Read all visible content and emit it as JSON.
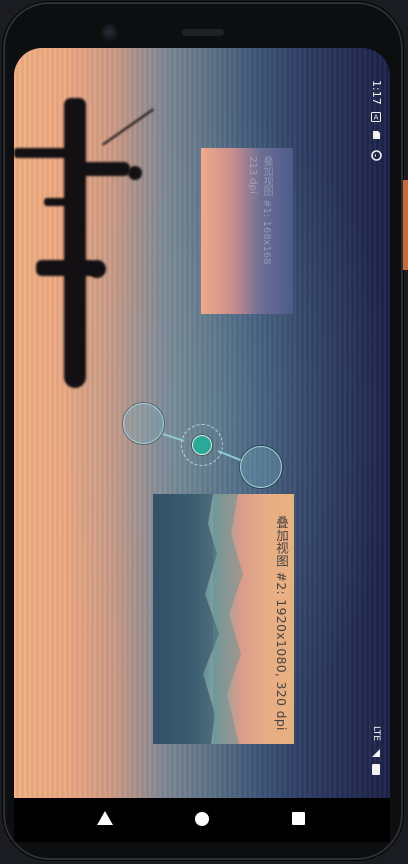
{
  "status_bar": {
    "time": "1:17",
    "network": "LTE",
    "icons": [
      "notification-a-icon",
      "sd-card-icon",
      "sync-icon",
      "signal-icon",
      "battery-icon"
    ]
  },
  "overlays": [
    {
      "label": "叠加视图 #1: 168x168",
      "dpi": "213 dpi"
    },
    {
      "label": "叠加视图 #2: 1920x1080, 320 dpi"
    }
  ],
  "navigation": {
    "back_icon": "back-triangle-icon",
    "home_icon": "home-circle-icon",
    "recents_icon": "recents-square-icon"
  },
  "colors": {
    "accent": "#2aa898",
    "handle_border": "#9fd4dc",
    "nav_bar": "#000000"
  }
}
